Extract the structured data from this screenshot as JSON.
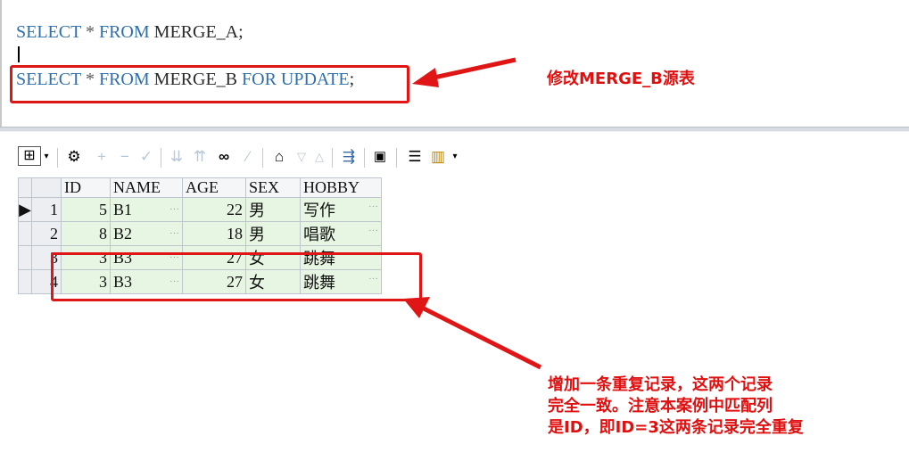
{
  "editor": {
    "query_a": {
      "kw1": "SELECT",
      "op": "*",
      "kw2": "FROM",
      "table": "MERGE_A",
      "end": ";"
    },
    "query_b": {
      "kw1": "SELECT",
      "op": "*",
      "kw2": "FROM",
      "table": "MERGE_B",
      "kw3": "FOR UPDATE",
      "end": ";"
    }
  },
  "annotations": {
    "top_note": "修改MERGE_B源表",
    "bottom_note_line1": "增加一条重复记录，这两个记录",
    "bottom_note_line2": "完全一致。注意本案例中匹配列",
    "bottom_note_line3": "是ID，即ID=3这两条记录完全重复"
  },
  "toolbar": {
    "icons": [
      "grid-icon",
      "dropdown-icon",
      "lock-icon",
      "plus-icon",
      "minus-icon",
      "check-icon",
      "filter-down-icon",
      "filter-up-icon",
      "binoculars-icon",
      "clear-icon",
      "query-icon",
      "triangle-down-icon",
      "triangle-up-icon",
      "connect-icon",
      "save-icon",
      "database-icon",
      "chart-icon",
      "dropdown-icon"
    ]
  },
  "grid": {
    "columns": [
      "ID",
      "NAME",
      "AGE",
      "SEX",
      "HOBBY"
    ],
    "rows": [
      {
        "rn": "1",
        "id": "5",
        "name": "B1",
        "age": "22",
        "sex": "男",
        "hobby": "写作"
      },
      {
        "rn": "2",
        "id": "8",
        "name": "B2",
        "age": "18",
        "sex": "男",
        "hobby": "唱歌"
      },
      {
        "rn": "3",
        "id": "3",
        "name": "B3",
        "age": "27",
        "sex": "女",
        "hobby": "跳舞"
      },
      {
        "rn": "4",
        "id": "3",
        "name": "B3",
        "age": "27",
        "sex": "女",
        "hobby": "跳舞"
      }
    ],
    "current_row_marker": "▶",
    "ellipsis": "···"
  },
  "colors": {
    "annotation_red": "#e01515",
    "row_bg": "#e7f6e2",
    "keyword": "#2f6fab"
  }
}
